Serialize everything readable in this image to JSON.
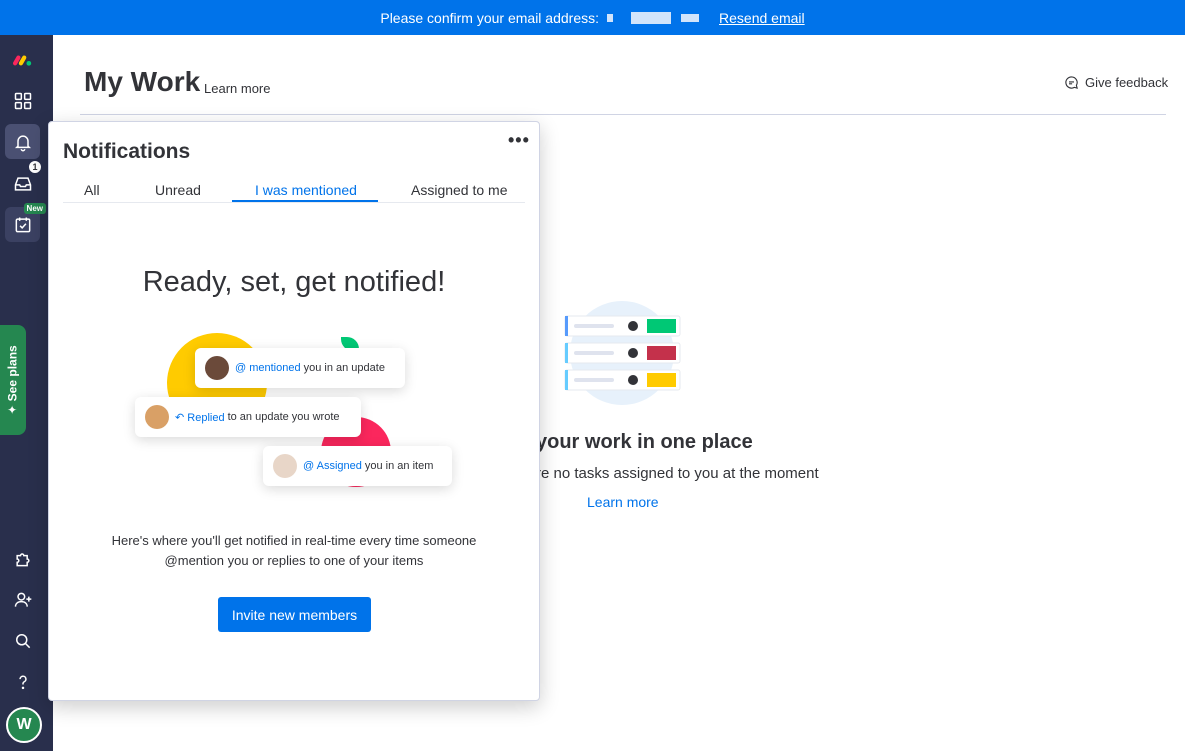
{
  "banner": {
    "message": "Please confirm your email address:",
    "resend_label": "Resend email"
  },
  "rail": {
    "inbox_badge": "1",
    "my_work_badge": "New",
    "see_plans_label": "See plans",
    "avatar_initial": "W"
  },
  "page": {
    "title": "My Work",
    "learn_more": "Learn more",
    "give_feedback": "Give feedback"
  },
  "empty_state": {
    "title": "your work in one place",
    "subtitle": "re no tasks assigned to you at the moment",
    "learn_more": "Learn more"
  },
  "notifications": {
    "title": "Notifications",
    "more_label": "•••",
    "tabs": [
      {
        "label": "All",
        "active": false
      },
      {
        "label": "Unread",
        "active": false
      },
      {
        "label": "I was mentioned",
        "active": true
      },
      {
        "label": "Assigned to me",
        "active": false
      }
    ],
    "headline": "Ready, set, get notified!",
    "cards": [
      {
        "action": "@ mentioned",
        "text": "you in an update"
      },
      {
        "action": "↶ Replied",
        "text": "to an update you wrote"
      },
      {
        "action": "@ Assigned",
        "text": "you in an item"
      }
    ],
    "description_line1": "Here's where you'll get notified in real-time every time someone",
    "description_line2": "@mention you or replies to one of your items",
    "invite_label": "Invite new members"
  },
  "colors": {
    "primary": "#0073ea",
    "rail_bg": "#292f4c",
    "green": "#258750",
    "yellow": "#ffcb00",
    "pink": "#fb275d",
    "status_green": "#00c875",
    "status_red": "#c4314b"
  }
}
